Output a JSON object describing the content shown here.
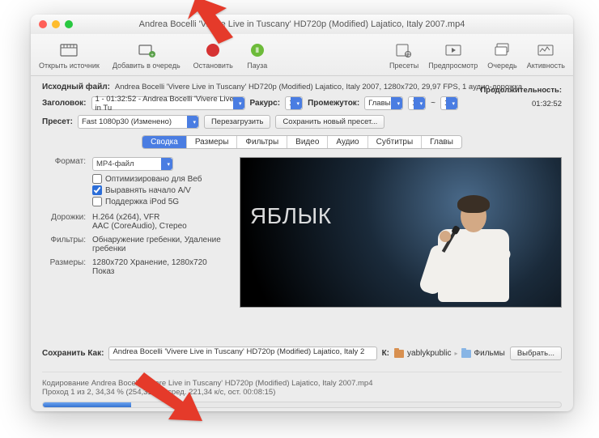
{
  "window": {
    "title": "Andrea Bocelli 'Vivere Live in Tuscany' HD720p (Modified) Lajatico, Italy  2007.mp4"
  },
  "toolbar": {
    "open_source": "Открыть источник",
    "add_queue": "Добавить в очередь",
    "stop": "Остановить",
    "pause": "Пауза",
    "presets": "Пресеты",
    "preview": "Предпросмотр",
    "queue": "Очередь",
    "activity": "Активность"
  },
  "info": {
    "source_lbl": "Исходный файл:",
    "source_val": "Andrea Bocelli 'Vivere Live in Tuscany' HD720p (Modified) Lajatico, Italy  2007, 1280x720, 29,97 FPS, 1 аудио-дорожка",
    "title_lbl": "Заголовок:",
    "title_val": "1 - 01:32:52 - Andrea Bocelli 'Vivere Live in Tu",
    "angle_lbl": "Ракурс:",
    "angle_val": "1",
    "range_lbl": "Промежуток:",
    "range_type": "Главы",
    "range_from": "1",
    "range_tilde": "~",
    "range_to": "1",
    "preset_lbl": "Пресет:",
    "preset_val": "Fast 1080p30 (Изменено)",
    "reload_btn": "Перезагрузить",
    "save_preset_btn": "Сохранить новый пресет...",
    "duration_lbl": "Продолжительность:",
    "duration_val": "01:32:52"
  },
  "tabs": {
    "summary": "Сводка",
    "dimensions": "Размеры",
    "filters": "Фильтры",
    "video": "Видео",
    "audio": "Аудио",
    "subtitles": "Субтитры",
    "chapters": "Главы"
  },
  "settings": {
    "format_lbl": "Формат:",
    "format_val": "MP4-файл",
    "opt_web": "Оптимизировано для Веб",
    "align_av": "Выравнять начало A/V",
    "ipod": "Поддержка iPod 5G",
    "tracks_lbl": "Дорожки:",
    "tracks_val": "H.264 (x264), VFR\nAAC (CoreAudio), Стерео",
    "filters_lbl": "Фильтры:",
    "filters_val": "Обнаружение гребенки, Удаление гребенки",
    "size_lbl": "Размеры:",
    "size_val": "1280x720 Хранение, 1280x720 Показ"
  },
  "preview": {
    "watermark": "Я БЛЫК"
  },
  "saveas": {
    "lbl": "Сохранить Как:",
    "filename": "Andrea Bocelli 'Vivere Live in Tuscany' HD720p (Modified) Lajatico, Italy  2",
    "dest_lbl": "К:",
    "path1": "yablykpublic",
    "path2": "Фильмы",
    "browse": "Выбрать..."
  },
  "status": {
    "line1": "Кодирование Andrea Bocelli 'Vivere Live in Tuscany' HD720p (Modified) Lajatico, Italy  2007.mp4",
    "line2": "Проход 1 из 2, 34,34 % (254,31 к/с, сред. 221,34 к/с, ост. 00:08:15)",
    "progress_pct": 17
  }
}
